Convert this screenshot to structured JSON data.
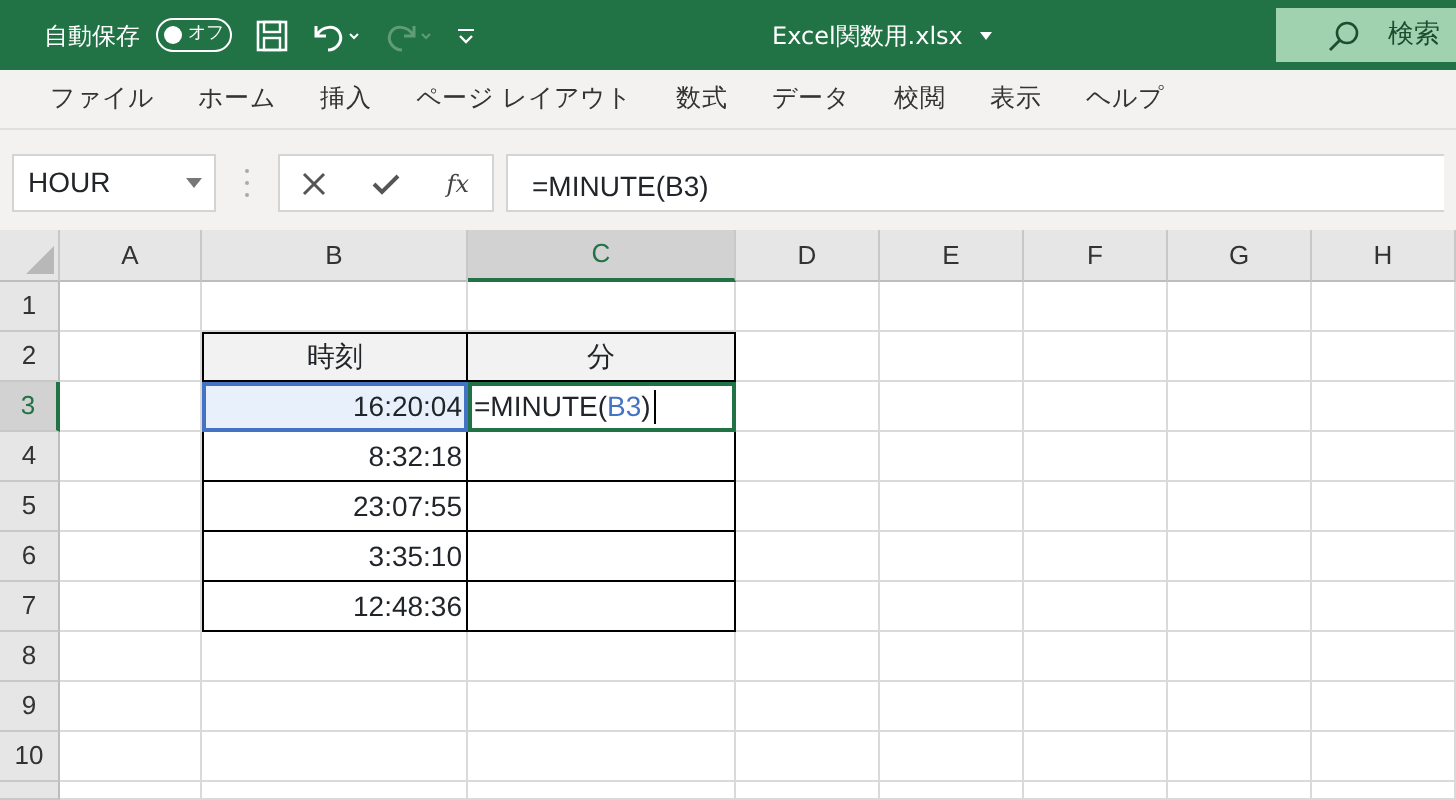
{
  "title_bar": {
    "autosave_label": "自動保存",
    "autosave_toggle": {
      "label": "オフ",
      "on": false
    },
    "undo": {
      "disabled": false
    },
    "redo": {
      "disabled": true
    },
    "file_name": "Excel関数用.xlsx",
    "search": {
      "placeholder": "検索"
    }
  },
  "ribbon_tabs": [
    {
      "label": "ファイル"
    },
    {
      "label": "ホーム"
    },
    {
      "label": "挿入"
    },
    {
      "label": "ページ レイアウト"
    },
    {
      "label": "数式"
    },
    {
      "label": "データ"
    },
    {
      "label": "校閲"
    },
    {
      "label": "表示"
    },
    {
      "label": "ヘルプ"
    }
  ],
  "formula_bar": {
    "name_box": "HOUR",
    "fx": "fx",
    "formula": "=MINUTE(B3)"
  },
  "sheet": {
    "columns": [
      {
        "label": "A",
        "selected": false
      },
      {
        "label": "B",
        "selected": false
      },
      {
        "label": "C",
        "selected": true
      },
      {
        "label": "D",
        "selected": false
      },
      {
        "label": "E",
        "selected": false
      },
      {
        "label": "F",
        "selected": false
      },
      {
        "label": "G",
        "selected": false
      },
      {
        "label": "H",
        "selected": false
      }
    ],
    "rows": [
      {
        "label": "1",
        "selected": false
      },
      {
        "label": "2",
        "selected": false
      },
      {
        "label": "3",
        "selected": true
      },
      {
        "label": "4",
        "selected": false
      },
      {
        "label": "5",
        "selected": false
      },
      {
        "label": "6",
        "selected": false
      },
      {
        "label": "7",
        "selected": false
      },
      {
        "label": "8",
        "selected": false
      },
      {
        "label": "9",
        "selected": false
      },
      {
        "label": "10",
        "selected": false
      }
    ],
    "table": {
      "headers": [
        "時刻",
        "分"
      ],
      "rows": [
        {
          "time": "16:20:04",
          "referenced": true,
          "minute": {
            "editing": true,
            "parts": [
              {
                "kind": "plain",
                "text": "=MINUTE("
              },
              {
                "kind": "ref",
                "text": "B3"
              },
              {
                "kind": "plain",
                "text": ")"
              }
            ]
          }
        },
        {
          "time": "8:32:18",
          "referenced": false,
          "minute": {
            "editing": false
          }
        },
        {
          "time": "23:07:55",
          "referenced": false,
          "minute": {
            "editing": false
          }
        },
        {
          "time": "3:35:10",
          "referenced": false,
          "minute": {
            "editing": false
          }
        },
        {
          "time": "12:48:36",
          "referenced": false,
          "minute": {
            "editing": false
          }
        }
      ]
    }
  }
}
